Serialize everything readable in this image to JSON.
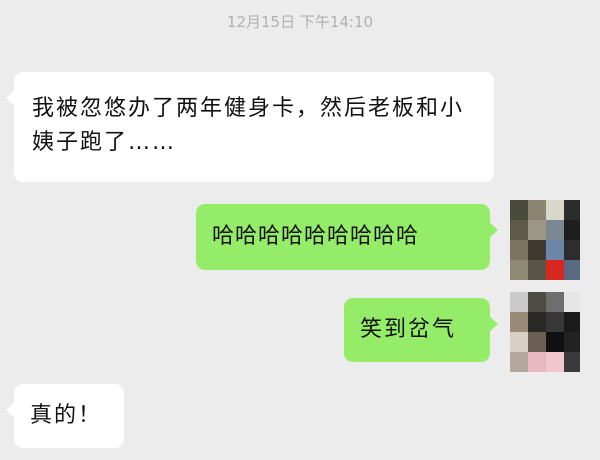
{
  "chat": {
    "timestamp": "12月15日 下午14:10",
    "messages": [
      {
        "side": "incoming",
        "text": "我被忽悠办了两年健身卡，然后老板和小姨子跑了……"
      },
      {
        "side": "outgoing",
        "text": "哈哈哈哈哈哈哈哈哈"
      },
      {
        "side": "outgoing",
        "text": "笑到岔气"
      },
      {
        "side": "incoming",
        "text": "真的！"
      }
    ],
    "colors": {
      "background": "#ececec",
      "incoming_bubble": "#ffffff",
      "outgoing_bubble": "#95ec69",
      "timestamp_text": "#b0b0b0"
    },
    "avatars": [
      {
        "name": "avatar-pixelated-icon"
      },
      {
        "name": "avatar-pixelated-icon"
      }
    ]
  }
}
